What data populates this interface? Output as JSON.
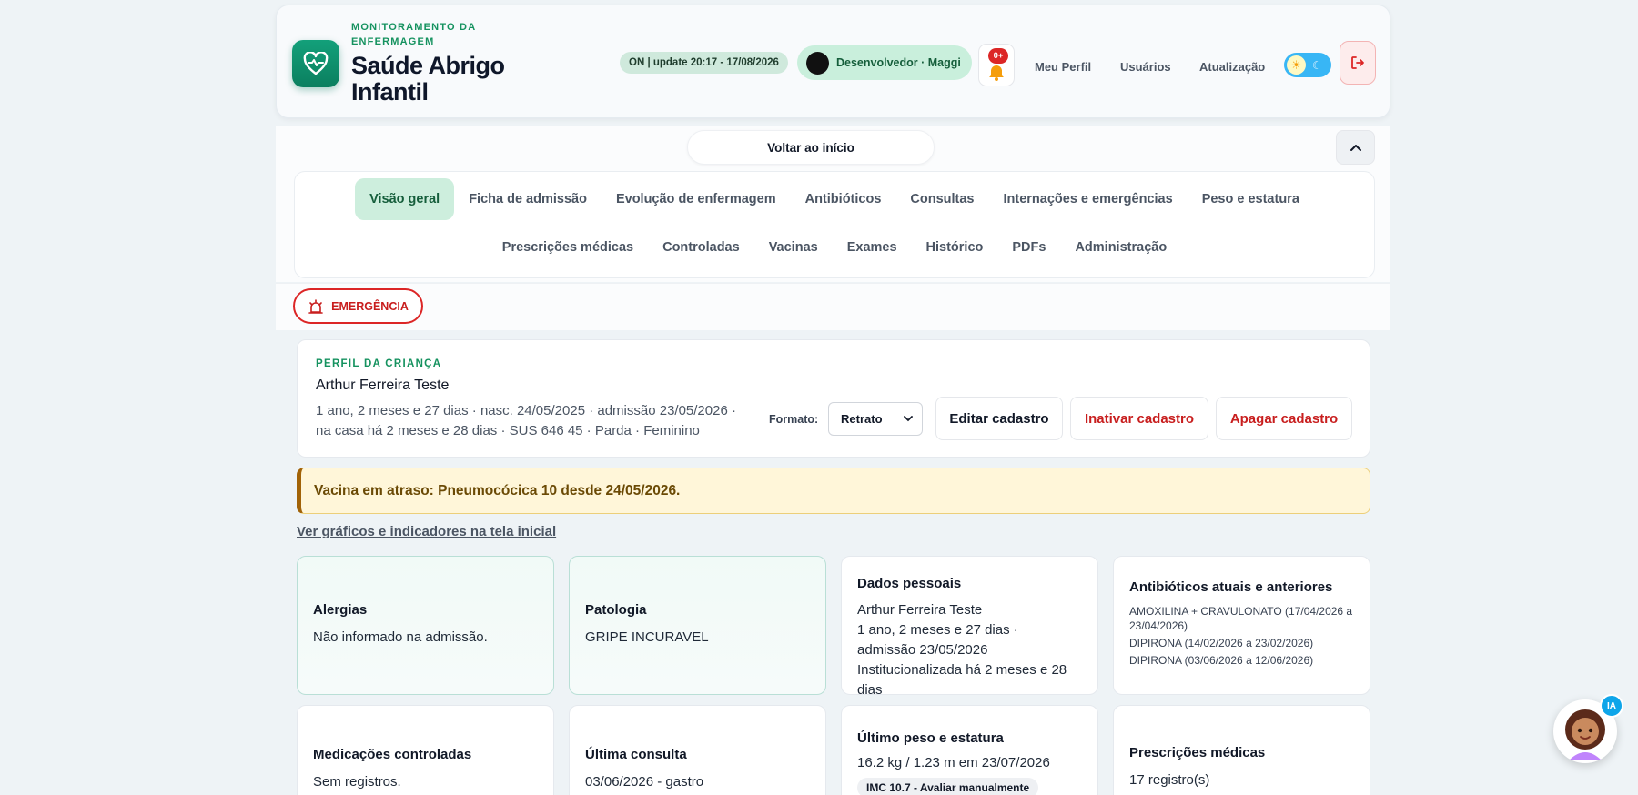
{
  "header": {
    "kicker": "MONITORAMENTO DA ENFERMAGEM",
    "title": "Saúde Abrigo Infantil",
    "status": "ON | update 20:17 - 17/08/2026",
    "user": "Desenvolvedor · Maggi",
    "notifications_badge": "0+",
    "links": [
      "Meu Perfil",
      "Usuários",
      "Atualização"
    ],
    "brand_color": "#0b7f5f"
  },
  "back_button": "Voltar ao início",
  "tabs": {
    "row1": [
      "Visão geral",
      "Ficha de admissão",
      "Evolução de enfermagem",
      "Antibióticos",
      "Consultas",
      "Internações e emergências",
      "Peso e estatura"
    ],
    "row2": [
      "Prescrições médicas",
      "Controladas",
      "Vacinas",
      "Exames",
      "Histórico",
      "PDFs",
      "Administração"
    ],
    "active": "Visão geral"
  },
  "emergency_button": "EMERGÊNCIA",
  "profile": {
    "kicker": "PERFIL DA CRIANÇA",
    "name": "Arthur Ferreira Teste",
    "meta_line1": "1 ano, 2 meses e 27 dias · nasc. 24/05/2025 · admissão 23/05/2026 ·",
    "meta_line2": "na casa há 2 meses e 28 dias · SUS 646 45 · Parda · Feminino",
    "format_label": "Formato:",
    "format_value": "Retrato",
    "edit_button": "Editar cadastro",
    "deactivate_button": "Inativar cadastro",
    "delete_button": "Apagar cadastro"
  },
  "alert": "Vacina em atraso: Pneumocócica 10 desde 24/05/2026.",
  "charts_link": "Ver gráficos e indicadores na tela inicial",
  "cards": {
    "allergies": {
      "title": "Alergias",
      "text": "Não informado na admissão."
    },
    "pathology": {
      "title": "Patologia",
      "text": "GRIPE INCURAVEL"
    },
    "personal": {
      "title": "Dados pessoais",
      "line1": "Arthur Ferreira Teste",
      "line2": "1 ano, 2 meses e 27 dias ·",
      "line3": "admissão 23/05/2026",
      "line4": "Institucionalizada há 2 meses e 28",
      "line5": "dias"
    },
    "antibiotics": {
      "title": "Antibióticos atuais e anteriores",
      "items": [
        "AMOXILINA + CRAVULONATO (17/04/2026 a 23/04/2026)",
        "DIPIRONA (14/02/2026 a 23/02/2026)",
        "DIPIRONA (03/06/2026 a 12/06/2026)"
      ]
    },
    "controlled": {
      "title": "Medicações controladas",
      "text": "Sem registros."
    },
    "last_consult": {
      "title": "Última consulta",
      "text": "03/06/2026 - gastro"
    },
    "weight": {
      "title": "Último peso e estatura",
      "text": "16.2 kg / 1.23 m em 23/07/2026",
      "badge": "IMC 10.7 - Avaliar manualmente"
    },
    "prescriptions": {
      "title": "Prescrições médicas",
      "text": "17 registro(s)"
    }
  },
  "ai_badge": "IA"
}
